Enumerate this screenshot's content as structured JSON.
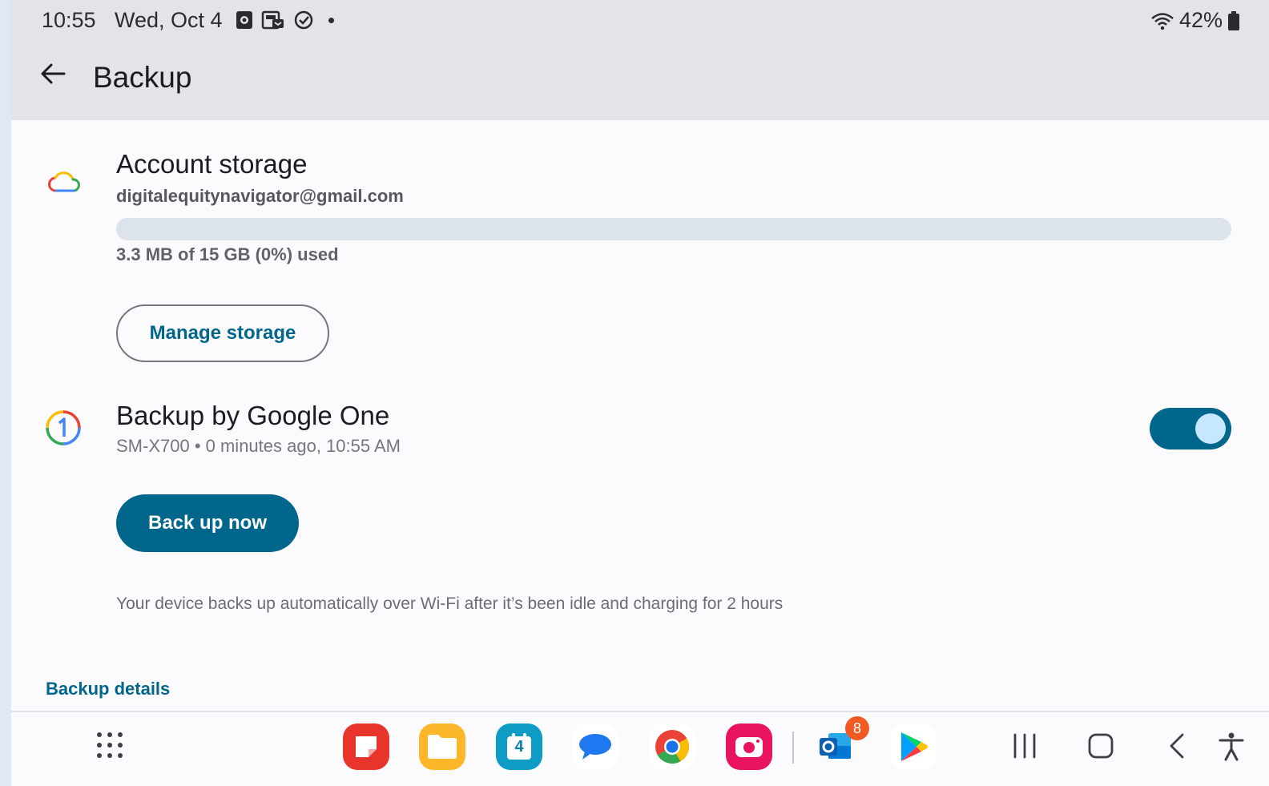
{
  "status_bar": {
    "time": "10:55",
    "date": "Wed, Oct 4",
    "battery": "42%"
  },
  "app_bar": {
    "title": "Backup"
  },
  "account_storage": {
    "title": "Account storage",
    "email": "digitalequitynavigator@gmail.com",
    "usage_text": "3.3 MB of 15 GB (0%) used",
    "usage_fraction": 0.0,
    "manage_button": "Manage storage"
  },
  "google_one": {
    "title": "Backup by Google One",
    "subtitle": "SM-X700 • 0 minutes ago, 10:55 AM",
    "toggle_on": true,
    "backup_button": "Back up now",
    "info": "Your device backs up automatically over Wi-Fi after it’s been idle and charging for 2 hours"
  },
  "backup_details_link": "Backup details",
  "taskbar": {
    "calendar_day": "4",
    "outlook_badge": "8",
    "apps": [
      "Samsung Notes",
      "My Files",
      "Calendar",
      "Messages",
      "Chrome",
      "Screen Recorder",
      "Outlook",
      "Play Store"
    ]
  },
  "colors": {
    "accent": "#00668b",
    "header_bg": "#e3e4e8",
    "surface": "#fbfbfd"
  }
}
